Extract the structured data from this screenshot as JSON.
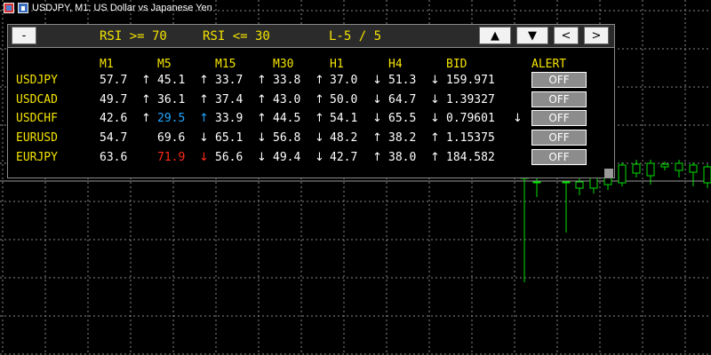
{
  "chart": {
    "title": "USDJPY, M1:  US Dollar vs Japanese Yen",
    "grid_color": "#8a8a8a",
    "candle_color": "#00e000"
  },
  "panel": {
    "minimize_label": "-",
    "rsi_high_label": "RSI >= 70",
    "rsi_low_label": "RSI <= 30",
    "page_label": "L-5 / 5",
    "nav_buttons": {
      "up": "▲",
      "down": "▼",
      "left": "<",
      "right": ">"
    },
    "columns": [
      "M1",
      "M5",
      "M15",
      "M30",
      "H1",
      "H4",
      "BID",
      "ALERT"
    ],
    "colors": {
      "symbol": "#f5e400",
      "value": "#ffffff",
      "oversold": "#1ea7ff",
      "overbought": "#ff2a1a"
    },
    "rows": [
      {
        "symbol": "USDJPY",
        "values": [
          "57.7",
          "45.1",
          "33.7",
          "33.8",
          "37.0",
          "51.3"
        ],
        "arrows": [
          "↑",
          "↑",
          "↑",
          "↑",
          "↓",
          "↓"
        ],
        "bid": "159.971",
        "bid_arrow": "",
        "alert": "OFF",
        "highlights": [
          null,
          null,
          null,
          null,
          null,
          null
        ]
      },
      {
        "symbol": "USDCAD",
        "values": [
          "49.7",
          "36.1",
          "37.4",
          "43.0",
          "50.0",
          "64.7"
        ],
        "arrows": [
          "↑",
          "↑",
          "↑",
          "↑",
          "↓",
          "↓"
        ],
        "bid": "1.39327",
        "bid_arrow": "",
        "alert": "OFF",
        "highlights": [
          null,
          null,
          null,
          null,
          null,
          null
        ]
      },
      {
        "symbol": "USDCHF",
        "values": [
          "42.6",
          "29.5",
          "33.9",
          "44.5",
          "54.1",
          "65.5"
        ],
        "arrows": [
          "↑",
          "↑",
          "↑",
          "↑",
          "↓",
          "↓"
        ],
        "bid": "0.79601",
        "bid_arrow": "↓",
        "alert": "OFF",
        "highlights": [
          null,
          "oversold",
          null,
          null,
          null,
          null
        ]
      },
      {
        "symbol": "EURUSD",
        "values": [
          "54.7",
          "69.6",
          "65.1",
          "56.8",
          "48.2",
          "38.2"
        ],
        "arrows": [
          "",
          "↓",
          "↓",
          "↓",
          "↑",
          "↑"
        ],
        "bid": "1.15375",
        "bid_arrow": "",
        "alert": "OFF",
        "highlights": [
          null,
          null,
          null,
          null,
          null,
          null
        ]
      },
      {
        "symbol": "EURJPY",
        "values": [
          "63.6",
          "71.9",
          "56.6",
          "49.4",
          "42.7",
          "38.0"
        ],
        "arrows": [
          "",
          "↓",
          "↓",
          "↓",
          "↑",
          "↑"
        ],
        "bid": "184.582",
        "bid_arrow": "",
        "alert": "OFF",
        "highlights": [
          null,
          "overbought",
          null,
          null,
          null,
          null
        ]
      }
    ]
  }
}
